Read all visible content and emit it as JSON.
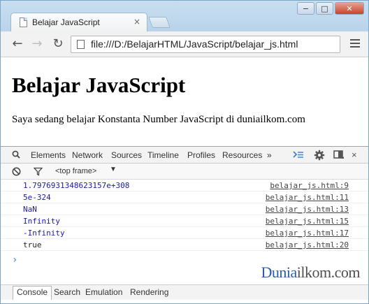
{
  "browser": {
    "tab_title": "Belajar JavaScript",
    "tab_close": "×",
    "url": "file:///D:/BelajarHTML/JavaScript/belajar_js.html",
    "window_controls": {
      "minimize": "−",
      "maximize": "□",
      "close": "✕"
    }
  },
  "page": {
    "heading": "Belajar JavaScript",
    "paragraph": "Saya sedang belajar Konstanta Number JavaScript di duniailkom.com"
  },
  "devtools": {
    "tabs": [
      "Elements",
      "Network",
      "Sources",
      "Timeline",
      "Profiles",
      "Resources"
    ],
    "more": "»",
    "close": "×",
    "frame_select": "<top frame>",
    "frame_arrow": "▼",
    "console_rows": [
      {
        "value": "1.7976931348623157e+308",
        "source": "belajar_js.html:9",
        "color": "#1a1aa6"
      },
      {
        "value": "5e-324",
        "source": "belajar_js.html:11",
        "color": "#1a1aa6"
      },
      {
        "value": "NaN",
        "source": "belajar_js.html:13",
        "color": "#1a1aa6"
      },
      {
        "value": "Infinity",
        "source": "belajar_js.html:15",
        "color": "#1a1aa6"
      },
      {
        "value": "-Infinity",
        "source": "belajar_js.html:17",
        "color": "#1a1aa6"
      },
      {
        "value": "true",
        "source": "belajar_js.html:20",
        "color": "#222222"
      }
    ],
    "prompt": "›",
    "drawer_tabs": [
      "Console",
      "Search",
      "Emulation",
      "Rendering"
    ]
  },
  "watermark": {
    "part1": "Dunia",
    "part2": "ilkom.com"
  }
}
